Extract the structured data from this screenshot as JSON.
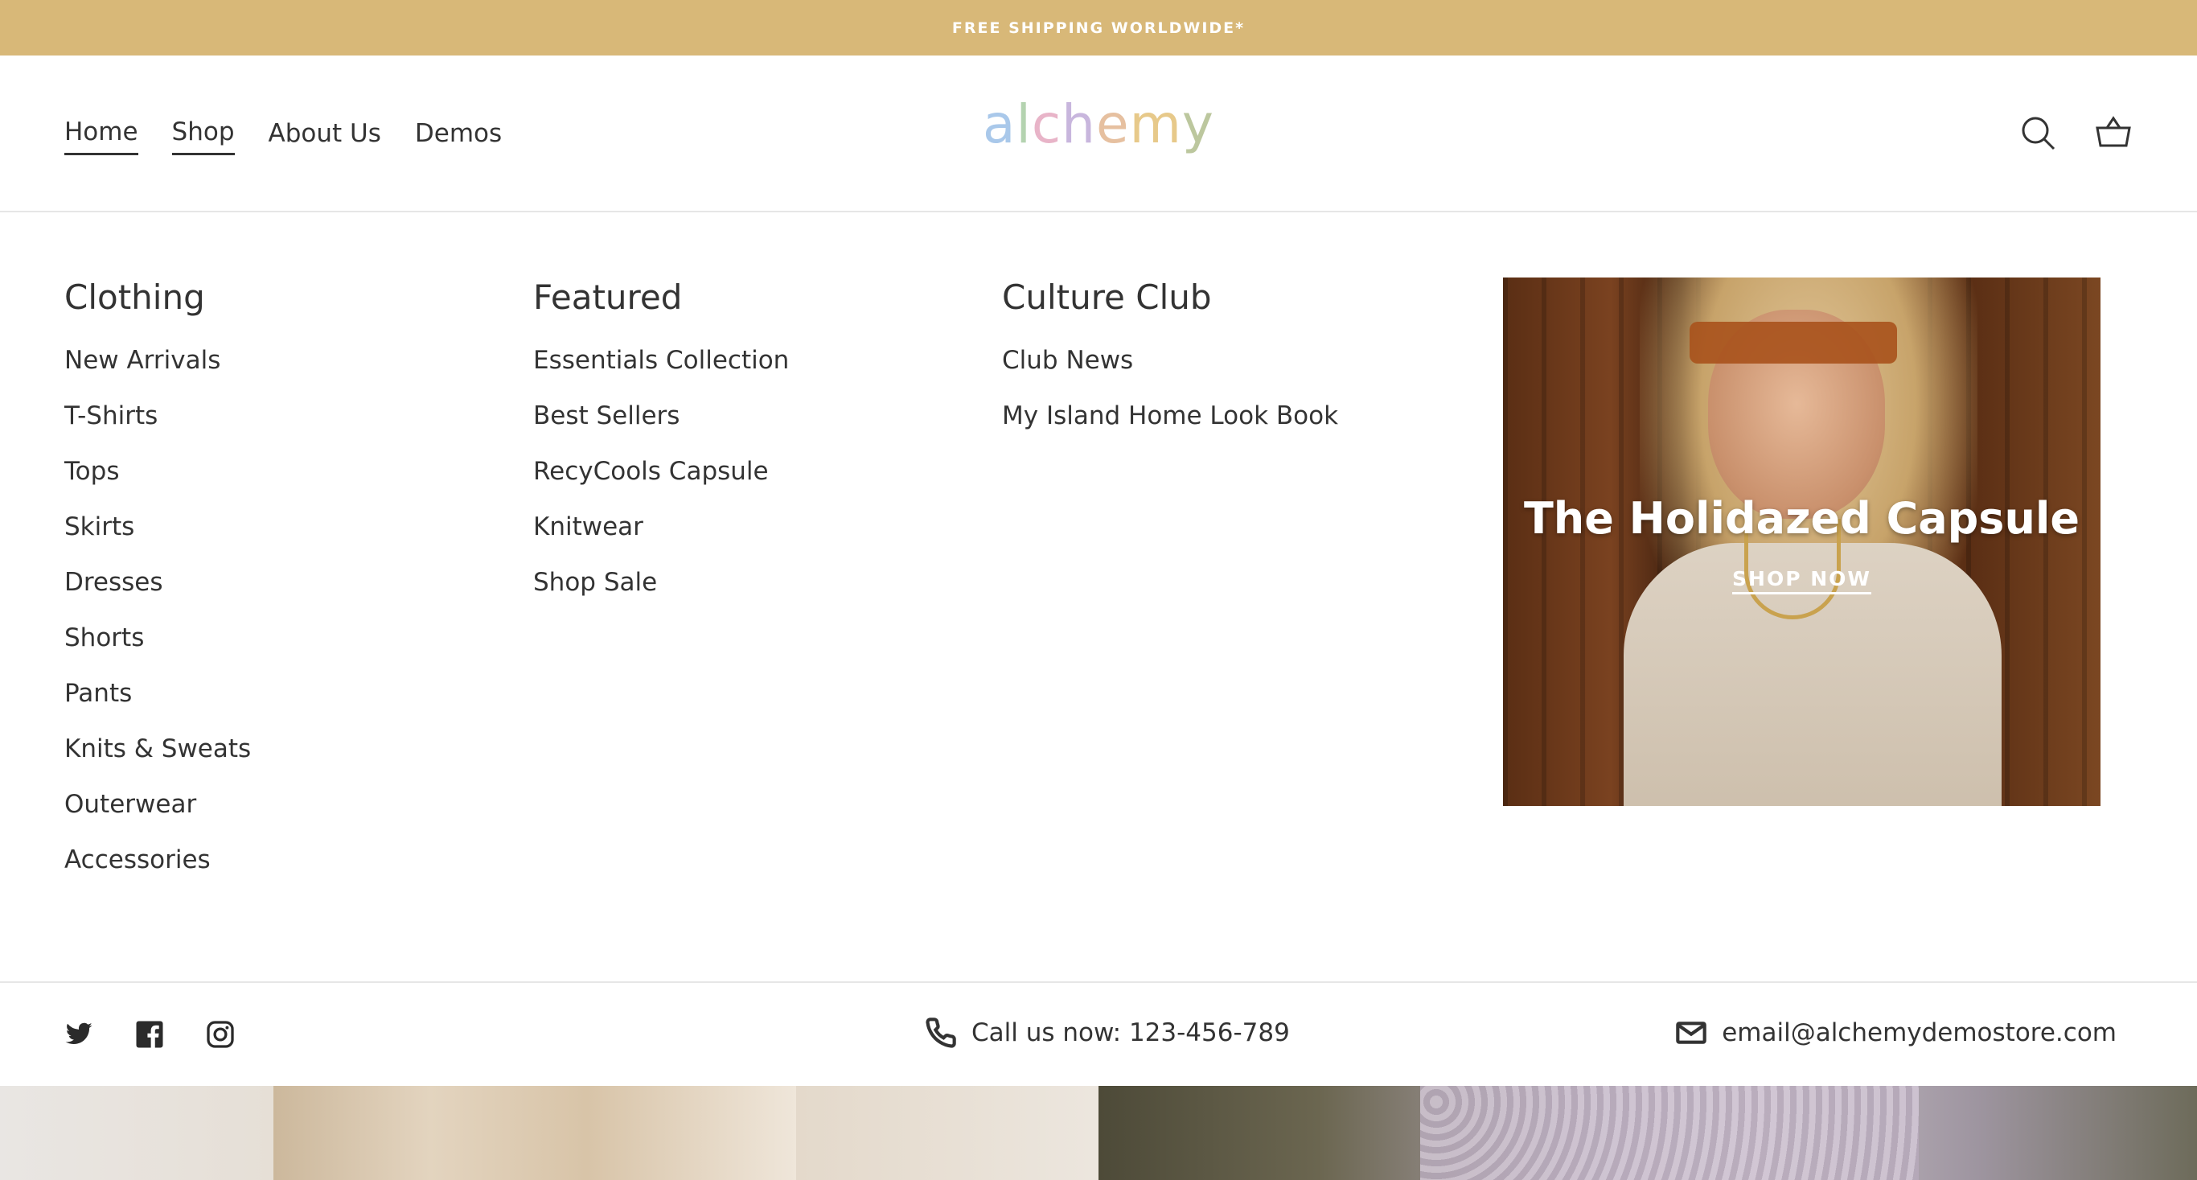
{
  "announcement": {
    "text": "FREE SHIPPING WORLDWIDE*"
  },
  "nav": {
    "items": [
      {
        "label": "Home"
      },
      {
        "label": "Shop"
      },
      {
        "label": "About Us"
      },
      {
        "label": "Demos"
      }
    ]
  },
  "logo": {
    "text": "alchemy",
    "letter_colors": [
      "#a9c8ea",
      "#b4d3b0",
      "#e8b4c8",
      "#c8b6dd",
      "#e6c0a0",
      "#e7c98a",
      "#bcc79e"
    ]
  },
  "header_icons": [
    "search-icon",
    "cart-icon"
  ],
  "mega_menu": {
    "clothing": {
      "heading": "Clothing",
      "links": [
        "New Arrivals",
        "T-Shirts",
        "Tops",
        "Skirts",
        "Dresses",
        "Shorts",
        "Pants",
        "Knits & Sweats",
        "Outerwear",
        "Accessories"
      ]
    },
    "featured": {
      "heading": "Featured",
      "links": [
        "Essentials Collection",
        "Best Sellers",
        "RecyCools Capsule",
        "Knitwear",
        "Shop Sale"
      ]
    },
    "culture_club": {
      "heading": "Culture Club",
      "links": [
        "Club News",
        "My Island Home Look Book"
      ]
    },
    "promo": {
      "title": "The Holidazed Capsule",
      "cta": "SHOP NOW"
    }
  },
  "contact": {
    "social_icons": [
      "twitter-icon",
      "facebook-icon",
      "instagram-icon"
    ],
    "phone_text": "Call us now: 123-456-789",
    "email_text": "email@alchemydemostore.com"
  },
  "colors": {
    "announcement_bg": "#d8b878",
    "text": "#333333",
    "divider": "#e6e6e6"
  }
}
